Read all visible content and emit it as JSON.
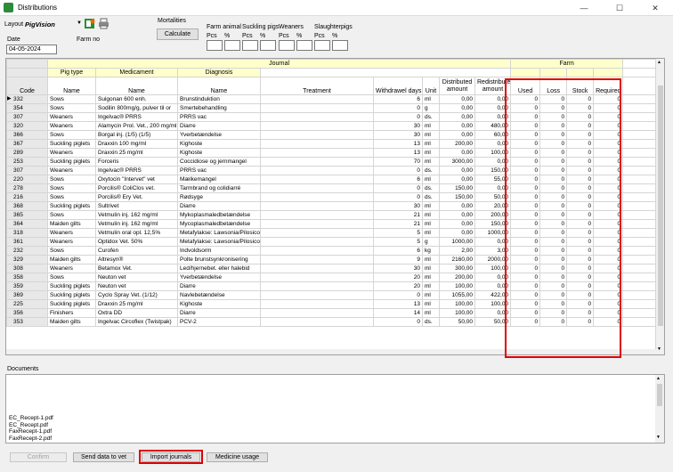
{
  "window": {
    "title": "Distributions",
    "minimize": "—",
    "maximize": "☐",
    "close": "✕"
  },
  "top": {
    "layout_label": "Layout",
    "layout_value": "PigVision",
    "mortalities_label": "Mortalities",
    "calculate_label": "Calculate",
    "date_label": "Date",
    "date_value": "04-05-2024",
    "farm_no_label": "Farm no",
    "groups": [
      {
        "name": "Farm animal",
        "pcs": "Pcs",
        "pct": "%"
      },
      {
        "name": "Suckling pigs",
        "pcs": "Pcs",
        "pct": "%"
      },
      {
        "name": "Weaners",
        "pcs": "Pcs",
        "pct": "%"
      },
      {
        "name": "Slaughterpigs",
        "pcs": "Pcs",
        "pct": "%"
      }
    ]
  },
  "grid": {
    "journal_label": "Journal",
    "farm_label": "Farm",
    "group_pig_type": "Pig type",
    "group_medicament": "Medicament",
    "group_diagnosis": "Diagnosis",
    "columns": {
      "code": "Code",
      "pig_type": "Name",
      "medicament": "Name",
      "diagnosis": "Name",
      "treatment": "Treatment",
      "withdrawal": "Withdrawel days",
      "unit": "Unit",
      "distributed": "Distributed amount",
      "redistributed": "Redistributed amount",
      "used": "Used",
      "loss": "Loss",
      "stock": "Stock",
      "required": "Required"
    },
    "rows": [
      {
        "code": "332",
        "pig": "Sows",
        "med": "Suigonan 600 enh.",
        "diag": "Brunstinduktion",
        "wd": "6",
        "unit": "ml",
        "dist": "0,00",
        "redist": "0,00",
        "used": "0",
        "loss": "0",
        "stock": "0",
        "req": "0"
      },
      {
        "code": "354",
        "pig": "Sows",
        "med": "Sodilin 800mg/g, pulver til or",
        "diag": "Smertebehandling",
        "wd": "0",
        "unit": "g",
        "dist": "0,00",
        "redist": "0,00",
        "used": "0",
        "loss": "0",
        "stock": "0",
        "req": "0"
      },
      {
        "code": "307",
        "pig": "Weaners",
        "med": "Ingelvac® PRRS",
        "diag": "PRRS vac",
        "wd": "0",
        "unit": "ds.",
        "dist": "0,00",
        "redist": "0,00",
        "used": "0",
        "loss": "0",
        "stock": "0",
        "req": "0"
      },
      {
        "code": "320",
        "pig": "Weaners",
        "med": "Alamycin Prol. Vet., 200 mg/ml",
        "diag": "Diarre",
        "wd": "30",
        "unit": "ml",
        "dist": "0,00",
        "redist": "480,00",
        "used": "0",
        "loss": "0",
        "stock": "0",
        "req": "0"
      },
      {
        "code": "366",
        "pig": "Sows",
        "med": "Borgal inj. (1/5) (1/5)",
        "diag": "Yverbetændelse",
        "wd": "30",
        "unit": "ml",
        "dist": "0,00",
        "redist": "60,00",
        "used": "0",
        "loss": "0",
        "stock": "0",
        "req": "0"
      },
      {
        "code": "367",
        "pig": "Suckling piglets",
        "med": "Draxxin 100 mg/ml",
        "diag": "Kighoste",
        "wd": "13",
        "unit": "ml",
        "dist": "200,00",
        "redist": "0,00",
        "used": "0",
        "loss": "0",
        "stock": "0",
        "req": "0"
      },
      {
        "code": "289",
        "pig": "Weaners",
        "med": "Draxxin 25 mg/ml",
        "diag": "Kighoste",
        "wd": "13",
        "unit": "ml",
        "dist": "0,00",
        "redist": "100,00",
        "used": "0",
        "loss": "0",
        "stock": "0",
        "req": "0"
      },
      {
        "code": "253",
        "pig": "Suckling piglets",
        "med": "Forceris",
        "diag": "Coccidiose og jernmangel",
        "wd": "70",
        "unit": "ml",
        "dist": "3000,00",
        "redist": "0,00",
        "used": "0",
        "loss": "0",
        "stock": "0",
        "req": "0"
      },
      {
        "code": "307",
        "pig": "Weaners",
        "med": "Ingelvac® PRRS",
        "diag": "PRRS vac",
        "wd": "0",
        "unit": "ds.",
        "dist": "0,00",
        "redist": "150,00",
        "used": "0",
        "loss": "0",
        "stock": "0",
        "req": "0"
      },
      {
        "code": "220",
        "pig": "Sows",
        "med": "Oxytocin \"Intervet\" vet",
        "diag": "Mælkemangel",
        "wd": "6",
        "unit": "ml",
        "dist": "0,00",
        "redist": "55,00",
        "used": "0",
        "loss": "0",
        "stock": "0",
        "req": "0"
      },
      {
        "code": "278",
        "pig": "Sows",
        "med": "Porcilis® ColiClos vet.",
        "diag": "Tarmbrand og colidiarré",
        "wd": "0",
        "unit": "ds.",
        "dist": "150,00",
        "redist": "0,00",
        "used": "0",
        "loss": "0",
        "stock": "0",
        "req": "0"
      },
      {
        "code": "216",
        "pig": "Sows",
        "med": "Porcilis® Ery Vet.",
        "diag": "Rødsyge",
        "wd": "0",
        "unit": "ds.",
        "dist": "150,00",
        "redist": "50,00",
        "used": "0",
        "loss": "0",
        "stock": "0",
        "req": "0"
      },
      {
        "code": "368",
        "pig": "Suckling piglets",
        "med": "Sultrivet",
        "diag": "Diarre",
        "wd": "30",
        "unit": "ml",
        "dist": "0,00",
        "redist": "20,00",
        "used": "0",
        "loss": "0",
        "stock": "0",
        "req": "0"
      },
      {
        "code": "365",
        "pig": "Sows",
        "med": "Vetmulin inj. 162 mg/ml",
        "diag": "Mykoplasmaledbetændelse",
        "wd": "21",
        "unit": "ml",
        "dist": "0,00",
        "redist": "200,00",
        "used": "0",
        "loss": "0",
        "stock": "0",
        "req": "0"
      },
      {
        "code": "364",
        "pig": "Maiden gilts",
        "med": "Vetmulin inj. 162 mg/ml",
        "diag": "Mycoplasmaledbetændelse",
        "wd": "21",
        "unit": "ml",
        "dist": "0,00",
        "redist": "150,00",
        "used": "0",
        "loss": "0",
        "stock": "0",
        "req": "0"
      },
      {
        "code": "318",
        "pig": "Weaners",
        "med": "Vetmulin oral opl. 12,5%",
        "diag": "Metafylakse: Lawsonia/Pilosicoli",
        "wd": "5",
        "unit": "ml",
        "dist": "0,00",
        "redist": "1000,00",
        "used": "0",
        "loss": "0",
        "stock": "0",
        "req": "0"
      },
      {
        "code": "361",
        "pig": "Weaners",
        "med": "Optidox Vet. 50%",
        "diag": "Metafylakse: Lawsonia/Pilosicoli",
        "wd": "5",
        "unit": "g",
        "dist": "1000,00",
        "redist": "0,00",
        "used": "0",
        "loss": "0",
        "stock": "0",
        "req": "0"
      },
      {
        "code": "232",
        "pig": "Sows",
        "med": "Curofen",
        "diag": "Indvoldsorm",
        "wd": "6",
        "unit": "kg",
        "dist": "2,00",
        "redist": "3,00",
        "used": "0",
        "loss": "0",
        "stock": "0",
        "req": "0"
      },
      {
        "code": "329",
        "pig": "Maiden gilts",
        "med": "Altresyn®",
        "diag": "Polte brunstsynkronisering",
        "wd": "9",
        "unit": "ml",
        "dist": "2160,00",
        "redist": "2000,00",
        "used": "0",
        "loss": "0",
        "stock": "0",
        "req": "0"
      },
      {
        "code": "308",
        "pig": "Weaners",
        "med": "Betamox Vet.",
        "diag": "Led/hjernebet. eller halebid",
        "wd": "30",
        "unit": "ml",
        "dist": "300,00",
        "redist": "100,00",
        "used": "0",
        "loss": "0",
        "stock": "0",
        "req": "0"
      },
      {
        "code": "358",
        "pig": "Sows",
        "med": "Neuton vet",
        "diag": "Yverbetændelse",
        "wd": "20",
        "unit": "ml",
        "dist": "200,00",
        "redist": "0,00",
        "used": "0",
        "loss": "0",
        "stock": "0",
        "req": "0"
      },
      {
        "code": "359",
        "pig": "Suckling piglets",
        "med": "Neuton vet",
        "diag": "Diarre",
        "wd": "20",
        "unit": "ml",
        "dist": "100,00",
        "redist": "0,00",
        "used": "0",
        "loss": "0",
        "stock": "0",
        "req": "0"
      },
      {
        "code": "369",
        "pig": "Suckling piglets",
        "med": "Cyclo Spray Vet. (1/12)",
        "diag": "Navlebetændelse",
        "wd": "0",
        "unit": "ml",
        "dist": "1055,00",
        "redist": "422,00",
        "used": "0",
        "loss": "0",
        "stock": "0",
        "req": "0"
      },
      {
        "code": "225",
        "pig": "Suckling piglets",
        "med": "Draxxin 25 mg/ml",
        "diag": "Kighoste",
        "wd": "13",
        "unit": "ml",
        "dist": "100,00",
        "redist": "100,00",
        "used": "0",
        "loss": "0",
        "stock": "0",
        "req": "0"
      },
      {
        "code": "356",
        "pig": "Finishers",
        "med": "Oxtra DD",
        "diag": "Diarre",
        "wd": "14",
        "unit": "ml",
        "dist": "100,00",
        "redist": "0,00",
        "used": "0",
        "loss": "0",
        "stock": "0",
        "req": "0"
      },
      {
        "code": "353",
        "pig": "Maiden gilts",
        "med": "Ingelvac Circoflex (Twistpak)",
        "diag": "PCV-2",
        "wd": "0",
        "unit": "ds.",
        "dist": "50,00",
        "redist": "50,00",
        "used": "0",
        "loss": "0",
        "stock": "0",
        "req": "0"
      }
    ]
  },
  "documents": {
    "label": "Documents",
    "files": [
      "EC_Recept-1.pdf",
      "EC_Recept.pdf",
      "FaxRecept-1.pdf",
      "FaxRecept-2.pdf"
    ]
  },
  "buttons": {
    "confirm": "Confirm",
    "send_to_vet": "Send data to vet",
    "import_journals": "Import journals",
    "medicine_usage": "Medicine usage"
  }
}
